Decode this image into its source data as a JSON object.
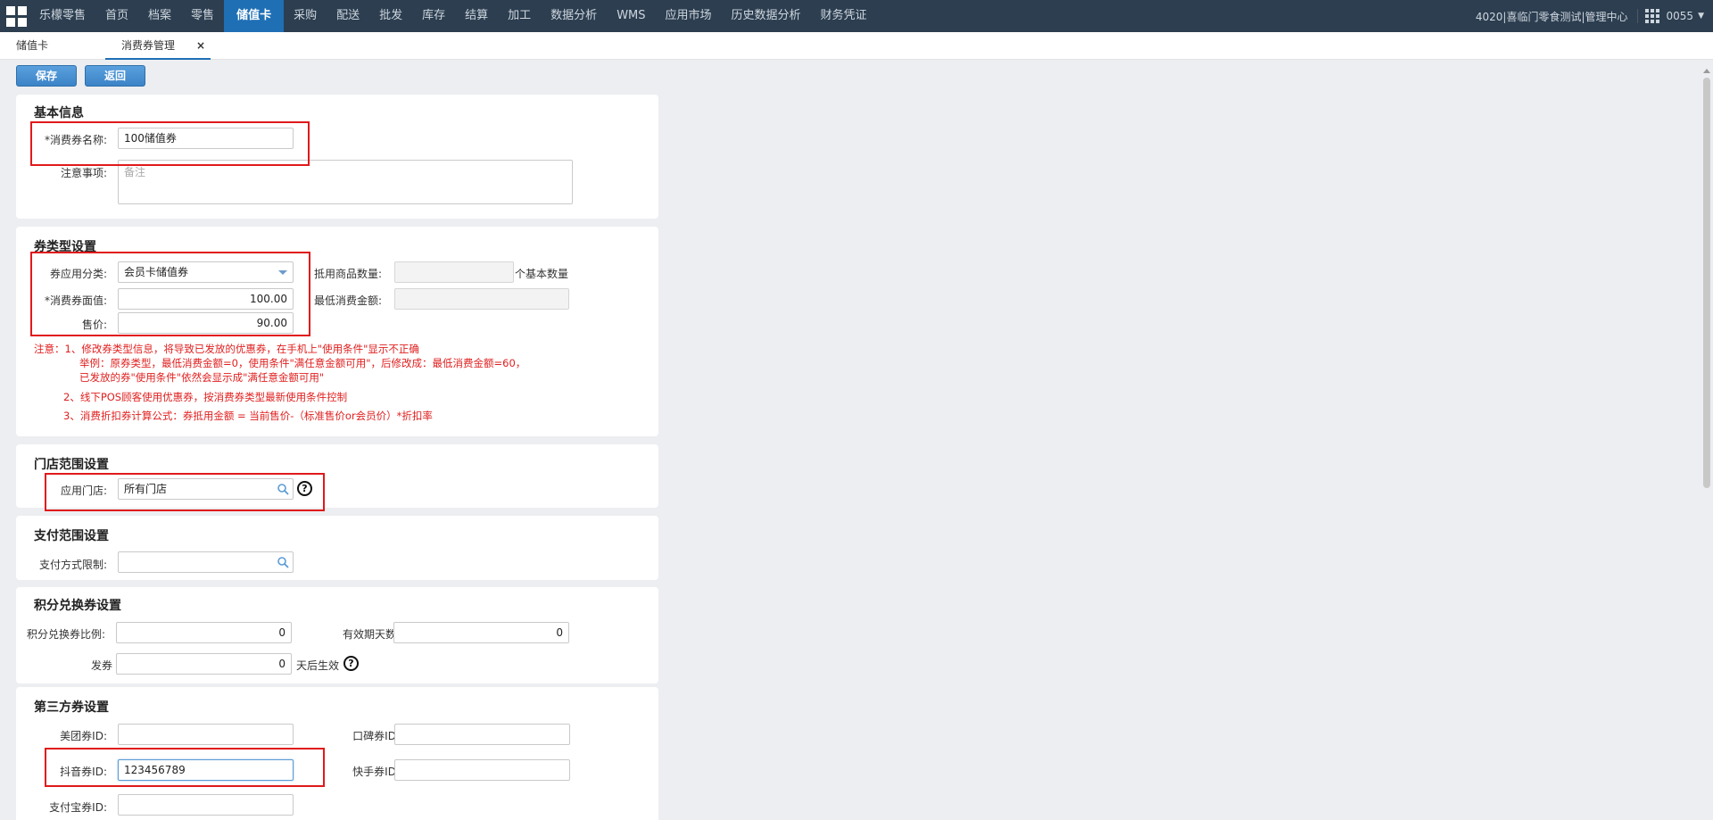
{
  "nav": {
    "brand": "乐檬零售",
    "items": [
      "首页",
      "档案",
      "零售",
      "储值卡",
      "采购",
      "配送",
      "批发",
      "库存",
      "结算",
      "加工",
      "数据分析",
      "WMS",
      "应用市场",
      "历史数据分析",
      "财务凭证"
    ],
    "active_index": 3,
    "org": "4020|喜临门零食测试|管理中心",
    "user": "0055"
  },
  "tabs": [
    {
      "label": "储值卡"
    },
    {
      "label": "消费券管理",
      "close": "×"
    }
  ],
  "toolbar": {
    "save_label": "保存",
    "back_label": "返回"
  },
  "basic": {
    "title": "基本信息",
    "name_label": "*消费券名称:",
    "name_value": "100储值券",
    "note_label": "注意事项:",
    "note_placeholder": "备注"
  },
  "type": {
    "title": "券类型设置",
    "category_label": "券应用分类:",
    "category_value": "会员卡储值券",
    "face_label": "*消费券面值:",
    "face_value": "100.00",
    "price_label": "售价:",
    "price_value": "90.00",
    "qty_label": "抵用商品数量:",
    "qty_suffix": "个基本数量",
    "min_label": "最低消费金额:",
    "notes": [
      "注意：1、修改券类型信息，将导致已发放的优惠券，在手机上\"使用条件\"显示不正确",
      "举例：原券类型，最低消费金额=0，使用条件\"满任意金额可用\"，后修改成：最低消费金额=60，",
      "已发放的券\"使用条件\"依然会显示成\"满任意金额可用\"",
      "2、线下POS顾客使用优惠券，按消费券类型最新使用条件控制",
      "3、消费折扣券计算公式：券抵用金额 = 当前售价-（标准售价or会员价）*折扣率"
    ]
  },
  "store": {
    "title": "门店范围设置",
    "store_label": "应用门店:",
    "store_value": "所有门店",
    "help": "?"
  },
  "payment": {
    "title": "支付范围设置",
    "pay_label": "支付方式限制:"
  },
  "points": {
    "title": "积分兑换券设置",
    "ratio_label": "积分兑换券比例:",
    "ratio_value": "0",
    "days_label": "有效期天数:",
    "days_value": "0",
    "issue_label": "发券",
    "issue_value": "0",
    "issue_suffix": "天后生效",
    "help": "?"
  },
  "third": {
    "title": "第三方券设置",
    "meituan_label": "美团券ID:",
    "koubei_label": "口碑券ID:",
    "douyin_label": "抖音券ID:",
    "douyin_value": "123456789",
    "kuaishou_label": "快手券ID:",
    "alipay_label": "支付宝券ID:"
  },
  "colors": {
    "nav_bg": "#2c3e50",
    "nav_active": "#1f6fb5",
    "highlight": "#e0191b",
    "note_text": "#e02020"
  }
}
